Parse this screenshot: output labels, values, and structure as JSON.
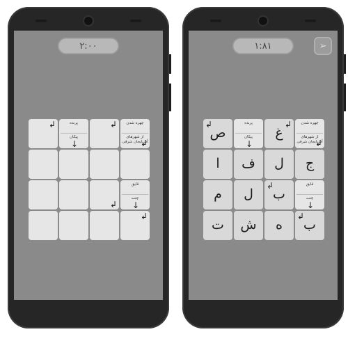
{
  "screens": [
    {
      "timer": "۲:۰۰",
      "show_hint": false,
      "cells": [
        {
          "r": 0,
          "c": 0,
          "letter": "",
          "arrow": "↲",
          "arrow_pos": "tr"
        },
        {
          "r": 0,
          "c": 1,
          "clue_top": "پرنده",
          "clue_bot": "پیکان",
          "arrow": "↓",
          "arrow_pos": "bc"
        },
        {
          "r": 0,
          "c": 2,
          "letter": "",
          "arrow": "↲",
          "arrow_pos": "tr"
        },
        {
          "r": 0,
          "c": 3,
          "clue_top": "چهره شدن",
          "clue_bot": "از شهرهای آذربایجان شرقی",
          "arrow": "↲",
          "arrow_pos": "br"
        },
        {
          "r": 1,
          "c": 0,
          "letter": ""
        },
        {
          "r": 1,
          "c": 1,
          "letter": ""
        },
        {
          "r": 1,
          "c": 2,
          "letter": ""
        },
        {
          "r": 1,
          "c": 3,
          "letter": ""
        },
        {
          "r": 2,
          "c": 0,
          "letter": ""
        },
        {
          "r": 2,
          "c": 1,
          "letter": ""
        },
        {
          "r": 2,
          "c": 2,
          "letter": "",
          "arrow": "↲",
          "arrow_pos": "br"
        },
        {
          "r": 2,
          "c": 3,
          "clue_top": "قایق",
          "clue_bot": "چنت",
          "arrow": "↓",
          "arrow_pos": "bc"
        },
        {
          "r": 3,
          "c": 0,
          "letter": ""
        },
        {
          "r": 3,
          "c": 1,
          "letter": ""
        },
        {
          "r": 3,
          "c": 2,
          "letter": ""
        },
        {
          "r": 3,
          "c": 3,
          "letter": "",
          "arrow": "↲",
          "arrow_pos": "tr"
        }
      ]
    },
    {
      "timer": "۱:۸۱",
      "show_hint": true,
      "hint_icon": "pin-icon",
      "cells": [
        {
          "r": 0,
          "c": 0,
          "letter": "ص",
          "arrow": "↲",
          "arrow_pos": "tl"
        },
        {
          "r": 0,
          "c": 1,
          "clue_top": "پرنده",
          "clue_bot": "پیکان",
          "arrow": "↓",
          "arrow_pos": "bc"
        },
        {
          "r": 0,
          "c": 2,
          "letter": "غ",
          "arrow": "↲",
          "arrow_pos": "tr"
        },
        {
          "r": 0,
          "c": 3,
          "clue_top": "چهره شدن",
          "clue_bot": "از شهرهای آذربایجان شرقی",
          "arrow": "↲",
          "arrow_pos": "br"
        },
        {
          "r": 1,
          "c": 0,
          "letter": "ا"
        },
        {
          "r": 1,
          "c": 1,
          "letter": "ف"
        },
        {
          "r": 1,
          "c": 2,
          "letter": "ل"
        },
        {
          "r": 1,
          "c": 3,
          "letter": "ج"
        },
        {
          "r": 2,
          "c": 0,
          "letter": "م"
        },
        {
          "r": 2,
          "c": 1,
          "letter": "ل"
        },
        {
          "r": 2,
          "c": 2,
          "letter": "ب",
          "arrow": "↲",
          "arrow_pos": "tl"
        },
        {
          "r": 2,
          "c": 3,
          "clue_top": "قایق",
          "clue_bot": "چنت",
          "arrow": "↓",
          "arrow_pos": "bc"
        },
        {
          "r": 3,
          "c": 0,
          "letter": "ت"
        },
        {
          "r": 3,
          "c": 1,
          "letter": "ش"
        },
        {
          "r": 3,
          "c": 2,
          "letter": "ه"
        },
        {
          "r": 3,
          "c": 3,
          "letter": "ب",
          "arrow": "↲",
          "arrow_pos": "tl"
        }
      ]
    }
  ]
}
